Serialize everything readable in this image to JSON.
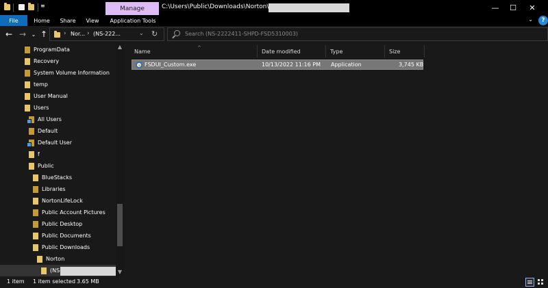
{
  "titlebar": {
    "manage_tab": "Manage",
    "path": "C:\\Users\\Public\\Downloads\\Norton\\(NS-",
    "minimize": "—",
    "maximize": "☐",
    "close": "✕"
  },
  "ribbon": {
    "tabs": [
      "File",
      "Home",
      "Share",
      "View",
      "Application Tools"
    ],
    "expand": "⌄",
    "help": "?"
  },
  "nav": {
    "back": "←",
    "forward": "→",
    "recent": "⌄",
    "up": "↑",
    "crumbs": [
      "Nor...",
      "(NS-222..."
    ],
    "crumb_sep": "›",
    "dropdown": "⌄",
    "refresh": "↻",
    "search_placeholder": "Search (NS-2222411-SHPD-FSD5310003)"
  },
  "tree": {
    "items": [
      {
        "label": "ProgramData"
      },
      {
        "label": "Recovery"
      },
      {
        "label": "System Volume Information"
      },
      {
        "label": "temp"
      },
      {
        "label": "User Manual"
      },
      {
        "label": "Users"
      },
      {
        "label": "All Users"
      },
      {
        "label": "Default"
      },
      {
        "label": "Default User"
      },
      {
        "label": "f"
      },
      {
        "label": "Public"
      },
      {
        "label": "BlueStacks"
      },
      {
        "label": "Libraries"
      },
      {
        "label": "NortonLifeLock"
      },
      {
        "label": "Public Account Pictures"
      },
      {
        "label": "Public Desktop"
      },
      {
        "label": "Public Documents"
      },
      {
        "label": "Public Downloads"
      },
      {
        "label": "Norton"
      },
      {
        "label": "(NS-"
      }
    ],
    "scroll_up": "▲",
    "scroll_down": "▼"
  },
  "columns": {
    "name": "Name",
    "date": "Date modified",
    "type": "Type",
    "size": "Size",
    "sort_indicator": "^"
  },
  "files": [
    {
      "name": "FSDUI_Custom.exe",
      "date": "10/13/2022 11:16 PM",
      "type": "Application",
      "size": "3,745 KB"
    }
  ],
  "status": {
    "count": "1 item",
    "selected": "1 item selected",
    "size": "3.65 MB"
  },
  "colors": {
    "accent": "#0f6cbd",
    "manage_tab": "#ddbbf6",
    "folder": "#e8c66a",
    "selection": "#777777"
  }
}
